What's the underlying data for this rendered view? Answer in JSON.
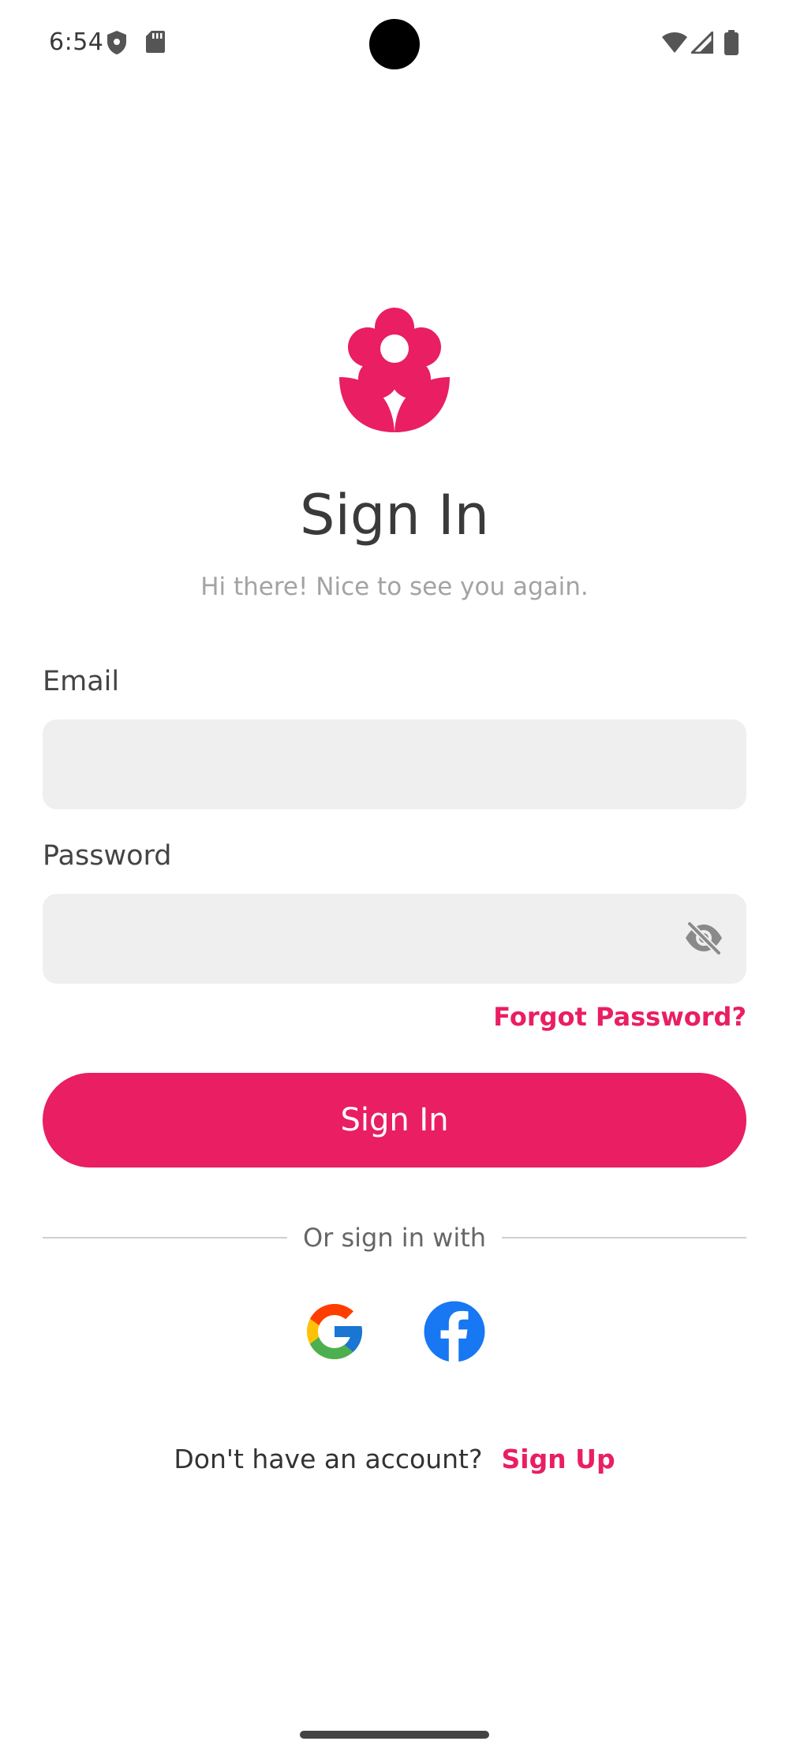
{
  "status_bar": {
    "time": "6:54",
    "icons": [
      "shield-icon",
      "sd-card-icon",
      "wifi-icon",
      "cellular-signal-icon",
      "battery-icon"
    ]
  },
  "app": {
    "logo_icon": "flower-icon",
    "accent_color": "#e91e63",
    "title": "Sign In",
    "subtitle": "Hi there! Nice to see you again."
  },
  "form": {
    "email_label": "Email",
    "email_value": "",
    "password_label": "Password",
    "password_value": "",
    "password_visibility_icon": "eye-off-icon",
    "forgot_password": "Forgot Password?",
    "submit_label": "Sign In"
  },
  "social": {
    "divider_text": "Or sign in with",
    "providers": [
      "google-icon",
      "facebook-icon"
    ]
  },
  "footer": {
    "prompt": "Don't have an account?",
    "signup_link": "Sign Up"
  }
}
